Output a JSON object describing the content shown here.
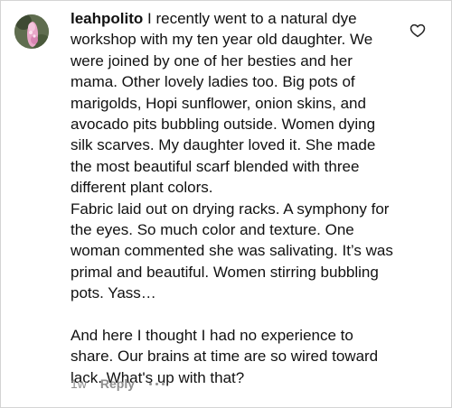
{
  "comment": {
    "username": "leahpolito",
    "paragraphs": [
      "I recently went to a natural dye workshop with my ten year old daughter. We were joined by one of her besties and her mama. Other lovely ladies too. Big pots of marigolds, Hopi sunflower, onion skins, and avocado pits bubbling outside. Women dying silk scarves. My daughter loved it. She made the most beautiful scarf blended with three different plant colors.",
      "Fabric laid out on drying racks. A symphony for the eyes. So much color and texture. One woman commented she was salivating. It’s was primal and beautiful. Women stirring bubbling pots. Yass…",
      "And here I thought I had no experience to share. Our brains at time are so wired toward lack. What's up with that?"
    ]
  },
  "meta": {
    "time": "1w",
    "reply_label": "Reply"
  },
  "icons": {
    "like": "heart-outline-icon",
    "more": "more-horizontal-icon",
    "avatar": "profile-photo"
  },
  "colors": {
    "text": "#111111",
    "muted": "#8e8e8e",
    "border": "#d4d4d4"
  }
}
